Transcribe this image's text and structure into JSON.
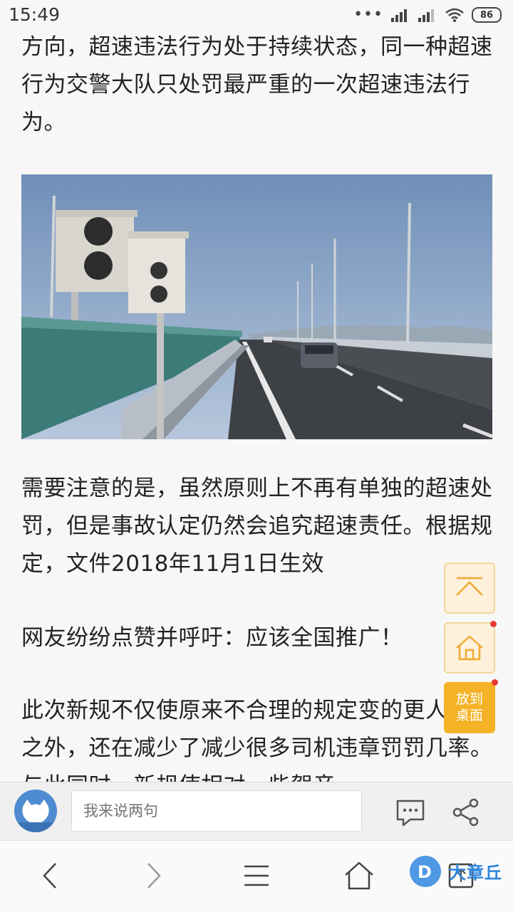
{
  "status_bar": {
    "time": "15:49",
    "battery": "86"
  },
  "article": {
    "paragraph_1": "方向，超速违法行为处于持续状态，同一种超速行为交警大队只处罚最严重的一次超速违法行为。",
    "image_alt": "highway speed cameras photo",
    "paragraph_2": "需要注意的是，虽然原则上不再有单独的超速处罚，但是事故认定仍然会追究超速责任。根据规定，文件2018年11月1日生效",
    "paragraph_3": "网友纷纷点赞并呼吁：应该全国推广！",
    "paragraph_4": "此次新规不仅使原来不合理的规定变的更人性化之外，还在减少了减少很多司机违章罚罚几率。与此同时，新规使相对一些驾音"
  },
  "floating": {
    "desktop_label_line1": "放到",
    "desktop_label_line2": "桌面"
  },
  "comment_bar": {
    "placeholder": "我来说两句"
  },
  "watermark": {
    "text": "大章丘"
  },
  "colors": {
    "accent_orange": "#f5b226",
    "avatar_blue": "#4f8bd0",
    "watermark_blue": "#2f86df"
  }
}
